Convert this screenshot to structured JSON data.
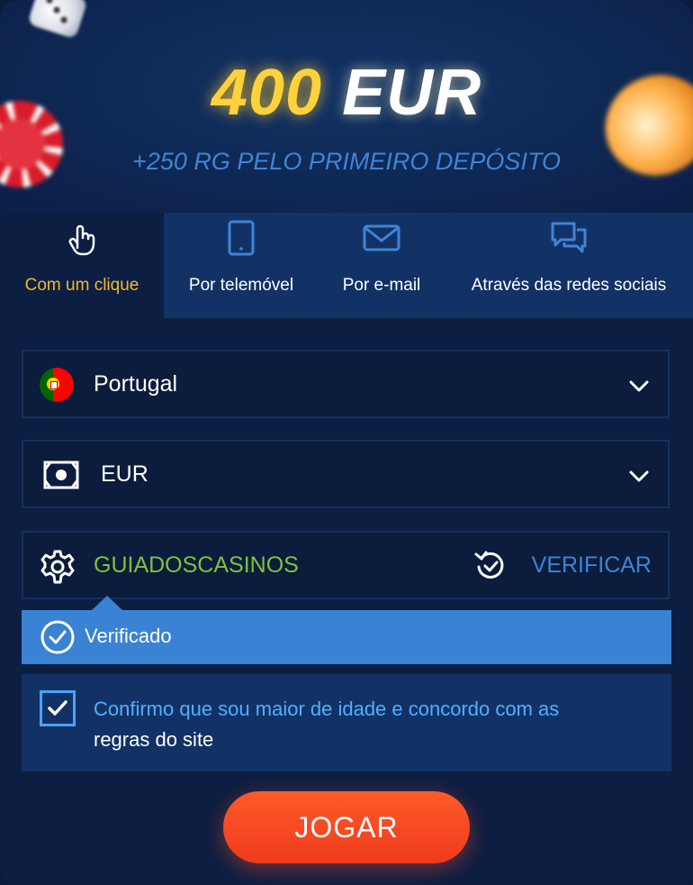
{
  "hero": {
    "amount": "400",
    "currency": "EUR",
    "subtitle": "+250 RG PELO PRIMEIRO DEPÓSITO"
  },
  "tabs": [
    {
      "label": "Com um clique",
      "icon": "hand-pointer-icon",
      "active": true
    },
    {
      "label": "Por telemóvel",
      "icon": "mobile-phone-icon",
      "active": false
    },
    {
      "label": "Por e-mail",
      "icon": "envelope-icon",
      "active": false
    },
    {
      "label": "Através das redes sociais",
      "icon": "chat-bubbles-icon",
      "active": false
    }
  ],
  "form": {
    "country": {
      "value": "Portugal",
      "icon": "portugal-flag-icon"
    },
    "currency": {
      "value": "EUR",
      "icon": "banknote-icon"
    },
    "promo": {
      "value": "GUIADOSCASINOS",
      "icon": "gear-icon",
      "verify_label": "VERIFICAR"
    },
    "verified_label": "Verificado",
    "terms": {
      "checked": true,
      "text_highlight": "Confirmo que sou maior de idade e concordo com as",
      "text_rest": "regras do site"
    }
  },
  "actions": {
    "play_label": "JOGAR"
  },
  "colors": {
    "background": "#0c1e42",
    "tab_inactive": "#123266",
    "accent_yellow": "#f5b731",
    "promo_green": "#7dc23c",
    "link_blue": "#3f84d6",
    "verified_blue": "#3a82d4",
    "play_red": "#ef3b1c"
  }
}
